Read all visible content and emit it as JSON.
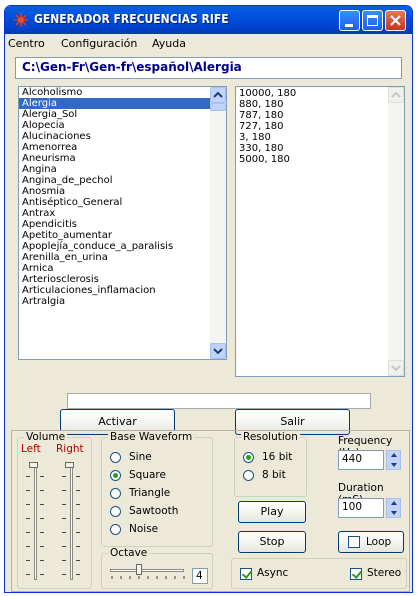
{
  "window": {
    "title": "GENERADOR FRECUENCIAS RIFE",
    "icon": "virus-icon"
  },
  "menu": [
    "Centro",
    "Configuración",
    "Ayuda"
  ],
  "path": "C:\\Gen-Fr\\Gen-fr\\español\\Alergia",
  "conditions": [
    "Alcoholismo",
    "Alergia",
    "Alergia_Sol",
    "Alopecia",
    "Alucinaciones",
    "Amenorrea",
    "Aneurisma",
    "Angina",
    "Angina_de_pechol",
    "Anosmia",
    "Antiséptico_General",
    "Antrax",
    "Apendicitis",
    "Apetito_aumentar",
    "Apoplejía_conduce_a_paralisis",
    "Arenilla_en_urina",
    "Arnica",
    "Arteriosclerosis",
    "Articulaciones_inflamacion",
    "Artralgia"
  ],
  "selected_condition": "Alergia",
  "frequencies": [
    "10000, 180",
    "880, 180",
    "787, 180",
    "727, 180",
    "3, 180",
    "330, 180",
    "5000, 180"
  ],
  "progress": 0,
  "buttons": {
    "activate": "Activar",
    "exit": "Salir",
    "play": "Play",
    "stop": "Stop"
  },
  "volume": {
    "label": "Volume",
    "left": "Left",
    "right": "Right",
    "left_level": 1.0,
    "right_level": 1.0
  },
  "waveform": {
    "label": "Base Waveform",
    "options": [
      "Sine",
      "Square",
      "Triangle",
      "Sawtooth",
      "Noise"
    ],
    "selected": "Square"
  },
  "octave": {
    "label": "Octave",
    "value": "4"
  },
  "resolution": {
    "label": "Resolution",
    "options": [
      "16 bit",
      "8 bit"
    ],
    "selected": "16 bit"
  },
  "frequency": {
    "label": "Frequency (Hz)",
    "value": "440"
  },
  "duration": {
    "label": "Duration (mS)",
    "value": "100"
  },
  "loop": {
    "label": "Loop",
    "checked": false
  },
  "async": {
    "label": "Async",
    "checked": true
  },
  "stereo": {
    "label": "Stereo",
    "checked": true
  },
  "colors": {
    "titlebar": "#0050de",
    "selection": "#316ac5",
    "path_text": "#00008a",
    "radio_dot": "#21a121"
  }
}
